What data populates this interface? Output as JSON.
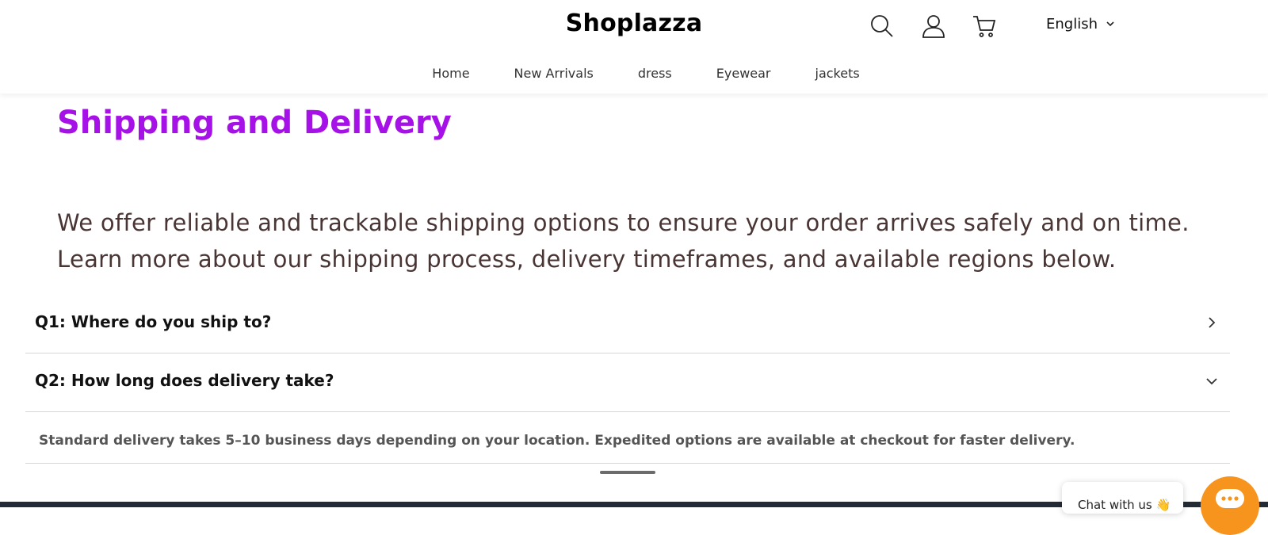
{
  "header": {
    "brand": "Shoplazza",
    "language": "English",
    "icons": [
      "search-icon",
      "account-icon",
      "cart-icon"
    ]
  },
  "nav": {
    "items": [
      "Home",
      "New Arrivals",
      "dress",
      "Eyewear",
      "jackets"
    ]
  },
  "page": {
    "title": "Shipping and Delivery",
    "intro_line1": "We offer reliable and trackable shipping options to ensure your order arrives safely and on time.",
    "intro_line2": "Learn more about our shipping process, delivery timeframes, and available regions below."
  },
  "faq": {
    "items": [
      {
        "question": "Q1: Where do you ship to?",
        "expanded": false
      },
      {
        "question": "Q2: How long does delivery take?",
        "expanded": true,
        "answer": "Standard delivery takes 5–10 business days depending on your location. Expedited options are available at checkout for faster delivery."
      }
    ]
  },
  "chat": {
    "label": "Chat with us 👋"
  },
  "colors": {
    "title": "#a511e6",
    "chat_button": "#f7941d",
    "footer": "#232b36"
  }
}
